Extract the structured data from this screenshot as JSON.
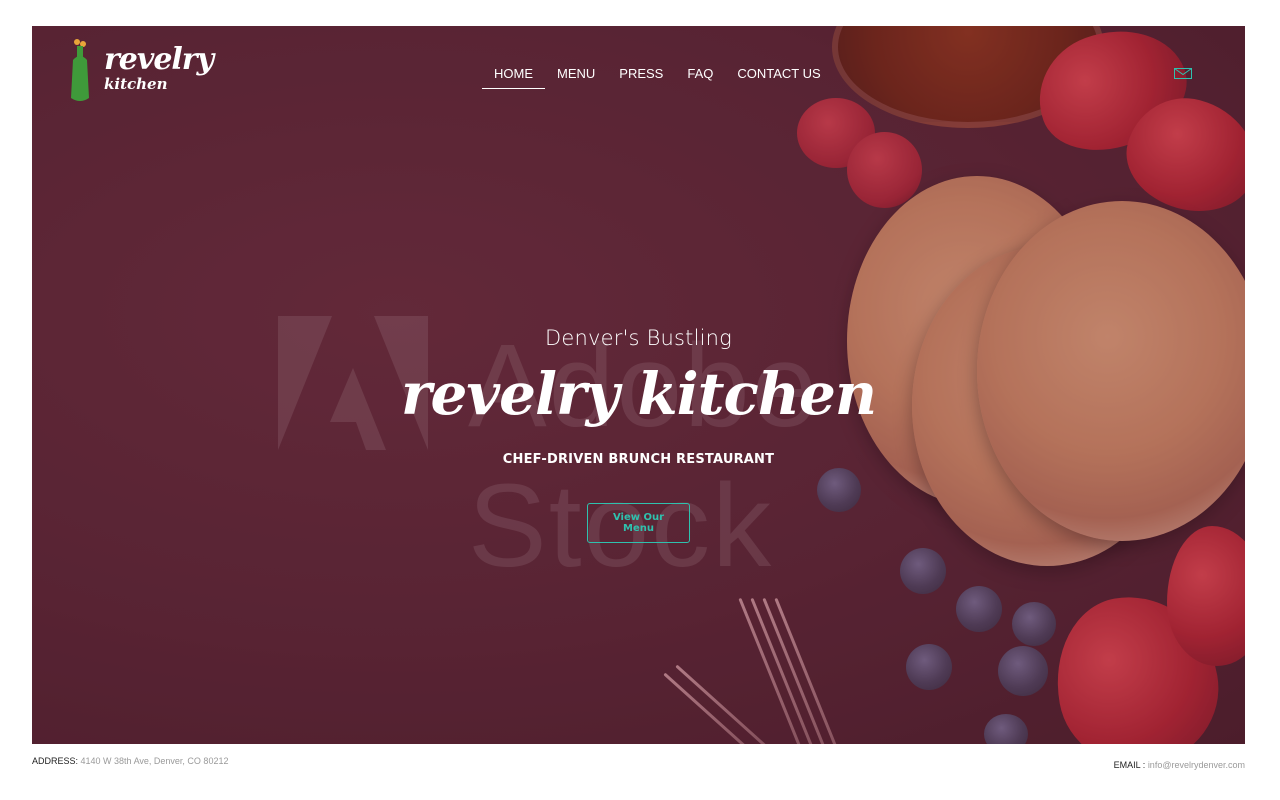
{
  "logo": {
    "line1": "revelry",
    "line2": "kitchen"
  },
  "nav": {
    "items": [
      {
        "label": "HOME",
        "active": true
      },
      {
        "label": "MENU",
        "active": false
      },
      {
        "label": "PRESS",
        "active": false
      },
      {
        "label": "FAQ",
        "active": false
      },
      {
        "label": "CONTACT US",
        "active": false
      }
    ],
    "mail_icon": "mail-icon"
  },
  "hero": {
    "subtitle": "Denver's Bustling",
    "brand": "revelry kitchen",
    "tagline": "CHEF-DRIVEN BRUNCH RESTAURANT",
    "cta_label": "View Our Menu",
    "watermark": "Adobe Stock"
  },
  "footer": {
    "address_label": "ADDRESS:",
    "address_value": "4140 W 38th Ave, Denver, CO 80212",
    "email_label": "EMAIL :",
    "email_value": "info@revelrydenver.com"
  },
  "colors": {
    "accent": "#2fc1ae",
    "hero_bg": "#4f2230"
  }
}
